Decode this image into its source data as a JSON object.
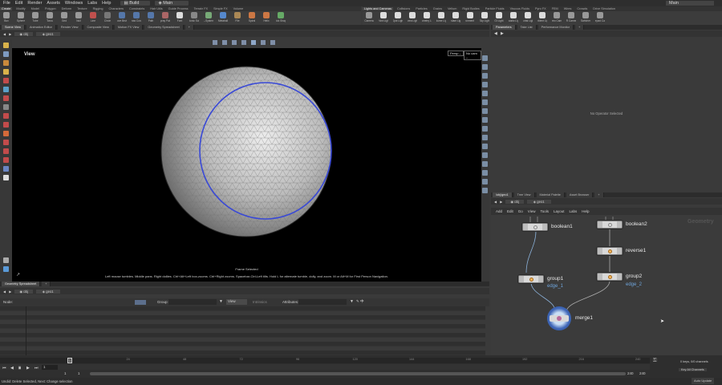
{
  "menu": [
    "File",
    "Edit",
    "Render",
    "Assets",
    "Windows",
    "Labs",
    "Help"
  ],
  "desktop": "Build",
  "scene": "Main",
  "shelf_tabs_left": [
    "Create",
    "Modify",
    "Model",
    "Polygon",
    "Deform",
    "Texture",
    "Rigging",
    "Characters",
    "Constraints",
    "Hair Utils",
    "Guide Process",
    "Terrain FX",
    "Simple FX",
    "Volume"
  ],
  "shelf_tabs_right": [
    "Lights and Cameras",
    "Collisions",
    "Particles",
    "Grains",
    "Vellum",
    "Rigid Bodies",
    "Particle Fluids",
    "Viscous Fluids",
    "Pyro FX",
    "FEM",
    "Wires",
    "Crowds",
    "Drive Simulation"
  ],
  "tools_left": [
    {
      "label": "Box",
      "color": "#9a9a9a"
    },
    {
      "label": "Sphere",
      "color": "#9a9a9a"
    },
    {
      "label": "Tube",
      "color": "#9a9a9a"
    },
    {
      "label": "Torus",
      "color": "#9a9a9a"
    },
    {
      "label": "Grid",
      "color": "#9a9a9a"
    },
    {
      "label": "Null",
      "color": "#9a9a9a"
    },
    {
      "label": "Line",
      "color": "#c0504d"
    },
    {
      "label": "Circle",
      "color": "#777"
    },
    {
      "label": "Curve Bezier",
      "color": "#5577aa"
    },
    {
      "label": "Draw Curve",
      "color": "#5577aa"
    },
    {
      "label": "Path",
      "color": "#5577aa"
    },
    {
      "label": "Spray Paint",
      "color": "#a66"
    },
    {
      "label": "Font",
      "color": "#ddd"
    },
    {
      "label": "Platonic Solids",
      "color": "#888"
    },
    {
      "label": "L-System",
      "color": "#7a7"
    },
    {
      "label": "Metaball",
      "color": "#5588cc"
    },
    {
      "label": "File",
      "color": "#aa8855"
    },
    {
      "label": "Spiral",
      "color": "#cc7744"
    },
    {
      "label": "Helix",
      "color": "#cc7744"
    },
    {
      "label": "Quick Shapes",
      "color": "#6a6"
    }
  ],
  "tools_right": [
    {
      "label": "Camera",
      "color": "#999"
    },
    {
      "label": "Point Light",
      "color": "#ddd"
    },
    {
      "label": "Spot Light",
      "color": "#ddd"
    },
    {
      "label": "Area Light",
      "color": "#ddd"
    },
    {
      "label": "Geometry Light",
      "color": "#ddd"
    },
    {
      "label": "Volume Light",
      "color": "#ddd"
    },
    {
      "label": "Distant Light",
      "color": "#ddd"
    },
    {
      "label": "Environment Light",
      "color": "#ddd"
    },
    {
      "label": "Sky Light",
      "color": "#ddd"
    },
    {
      "label": "GI Light",
      "color": "#ddd"
    },
    {
      "label": "Caustic Light",
      "color": "#ddd"
    },
    {
      "label": "Portal Light",
      "color": "#ddd"
    },
    {
      "label": "Ambient Light",
      "color": "#ddd"
    },
    {
      "label": "Stereo Camera",
      "color": "#999"
    },
    {
      "label": "VR Camera",
      "color": "#999"
    },
    {
      "label": "Switcher",
      "color": "#999"
    },
    {
      "label": "Gamepad Camera",
      "color": "#999"
    }
  ],
  "left_tabs": [
    "Scene View",
    "Animation Editor",
    "Render View",
    "Composite View",
    "Motion FX View",
    "Geometry Spreadsheet"
  ],
  "right_top_tabs": [
    "Parameters",
    "Take List",
    "Performance Monitor"
  ],
  "right_bottom_tabs": [
    "/obj/geo1",
    "Tree View",
    "Material Palette",
    "Asset Browser"
  ],
  "path": {
    "context": "obj",
    "node": "geo1"
  },
  "viewport": {
    "label": "View",
    "persp": "Persp –",
    "cam": "No cam –",
    "hud_title": "Frame Selected",
    "hud_text": "Left mouse tumbles. Middle pans. Right dollies. Ctrl+Alt+Left box-zooms. Ctrl+Right zooms. Spacebar-Ctrl-Left tilts. Hold L for alternate tumble, dolly, and zoom. M or Alt+M for First Person Navigation."
  },
  "parameters": {
    "empty": "No Operator Selected"
  },
  "network": {
    "menu": [
      "Add",
      "Edit",
      "Go",
      "View",
      "Tools",
      "Layout",
      "Labs",
      "Help"
    ],
    "context_label": "Geometry",
    "nodes": [
      {
        "name": "boolean1",
        "sub": ""
      },
      {
        "name": "boolean2",
        "sub": ""
      },
      {
        "name": "reverse1",
        "sub": ""
      },
      {
        "name": "group1",
        "sub": "edge_1"
      },
      {
        "name": "group2",
        "sub": "edge_2"
      },
      {
        "name": "merge1",
        "sub": ""
      }
    ]
  },
  "spreadsheet": {
    "tab": "Geometry Spreadsheet",
    "node_label": "Node:",
    "group_label": "Group:",
    "view_label": "View",
    "intrinsics_label": "Intrinsics",
    "attributes_label": "Attributes:"
  },
  "timeline": {
    "frame": "1",
    "start": "1",
    "start2": "1",
    "end": "240",
    "end2": "240",
    "ticks": [
      "24",
      "48",
      "72",
      "96",
      "120",
      "144",
      "168",
      "192",
      "216",
      "240"
    ],
    "keys_label": "0 keys, 0/0 channels",
    "key_all": "Key All Channels",
    "auto_update": "Auto Update"
  },
  "status": "Undid: Delete Selected, Next: Change selection",
  "colors": {
    "accent": "#3f67b8",
    "wire_sel": "#3949d6",
    "node_badge": "#f3b75c",
    "sub_label": "#6fa5dc"
  }
}
